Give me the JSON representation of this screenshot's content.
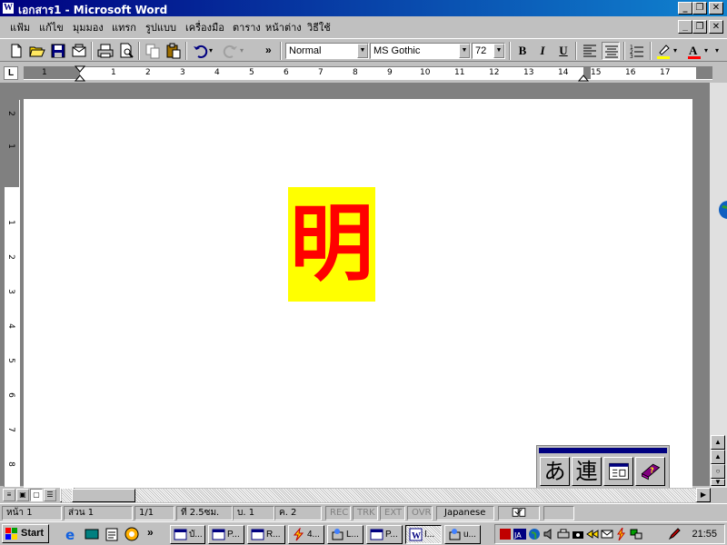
{
  "window": {
    "title": "เอกสาร1 - Microsoft Word"
  },
  "menu": [
    "แฟ้ม",
    "แก้ไข",
    "มุมมอง",
    "แทรก",
    "รูปแบบ",
    "เครื่องมือ",
    "ตาราง",
    "หน้าต่าง",
    "วิธีใช้"
  ],
  "toolbar": {
    "style": "Normal",
    "font": "MS Gothic",
    "size": "72",
    "bold": "B",
    "italic": "I",
    "underline": "U",
    "more": "»"
  },
  "ruler": {
    "numbers": [
      "1",
      "1",
      "2",
      "3",
      "4",
      "5",
      "6",
      "7",
      "8",
      "9",
      "10",
      "11",
      "12",
      "13",
      "14",
      "15",
      "16",
      "17"
    ]
  },
  "vruler": {
    "numbers": [
      "2",
      "1",
      "1",
      "2",
      "3",
      "4",
      "5",
      "6",
      "7",
      "8"
    ]
  },
  "document": {
    "text": "明",
    "text_color": "#ff0000",
    "highlight_color": "#ffff00"
  },
  "ime": {
    "mode": "あ",
    "conversion": "連"
  },
  "status": {
    "page": "หน้า 1",
    "section": "ส่วน 1",
    "pages": "1/1",
    "at": "ที่ 2.5ซม.",
    "line": "บ. 1",
    "col": "ค. 2",
    "rec": "REC",
    "trk": "TRK",
    "ext": "EXT",
    "ovr": "OVR",
    "language": "Japanese"
  },
  "taskbar": {
    "start": "Start",
    "buttons": [
      "บั...",
      "P...",
      "R...",
      "4...",
      "L...",
      "P...",
      "I...",
      "u..."
    ],
    "clock": "21:55"
  }
}
